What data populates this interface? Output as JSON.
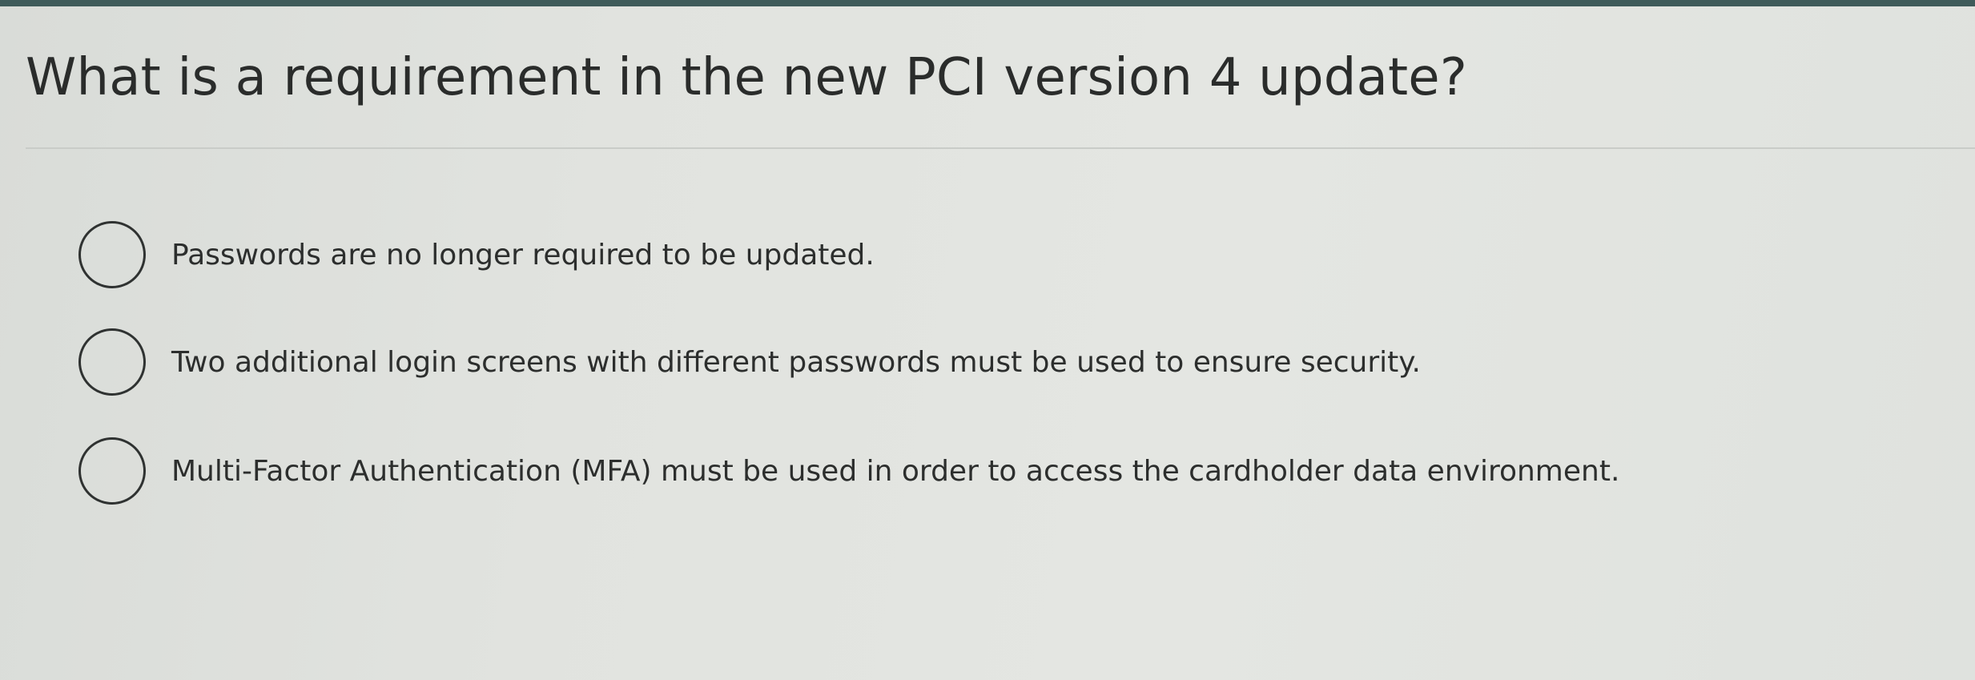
{
  "question": {
    "text": "What is a requirement in the new PCI version 4 update?"
  },
  "options": [
    {
      "label": "Passwords are no longer required to be updated.",
      "selected": false
    },
    {
      "label": "Two additional login screens with different passwords must be used to ensure security.",
      "selected": false
    },
    {
      "label": "Multi-Factor Authentication (MFA) must be used in order to access the cardholder data environment.",
      "selected": false
    }
  ],
  "colors": {
    "header_bar": "#3f5b5a",
    "text": "#2a2c2b",
    "background": "#e1e3df"
  },
  "icons": {
    "radio": "radio-button-unchecked-icon"
  }
}
